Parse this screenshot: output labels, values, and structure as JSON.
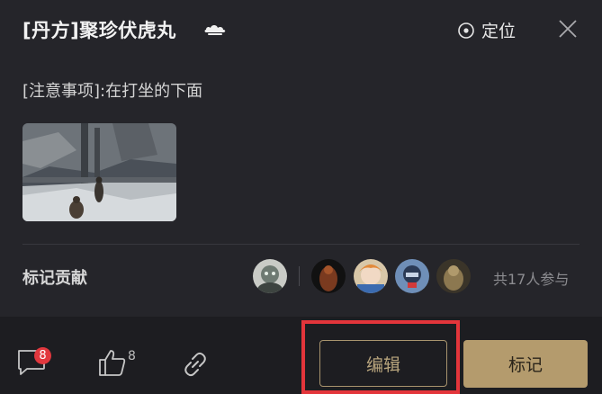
{
  "header": {
    "title": "[丹方]聚珍伏虎丸",
    "locate_label": "定位"
  },
  "note": "[注意事项]:在打坐的下面",
  "contributors": {
    "label": "标记贡献",
    "summary": "共17人参与"
  },
  "actions": {
    "comment_count": "8",
    "like_count": "8",
    "edit_label": "编辑",
    "mark_label": "标记"
  },
  "colors": {
    "accent": "#b49b6d",
    "badge": "#e2383e",
    "highlight": "#e3353b"
  }
}
